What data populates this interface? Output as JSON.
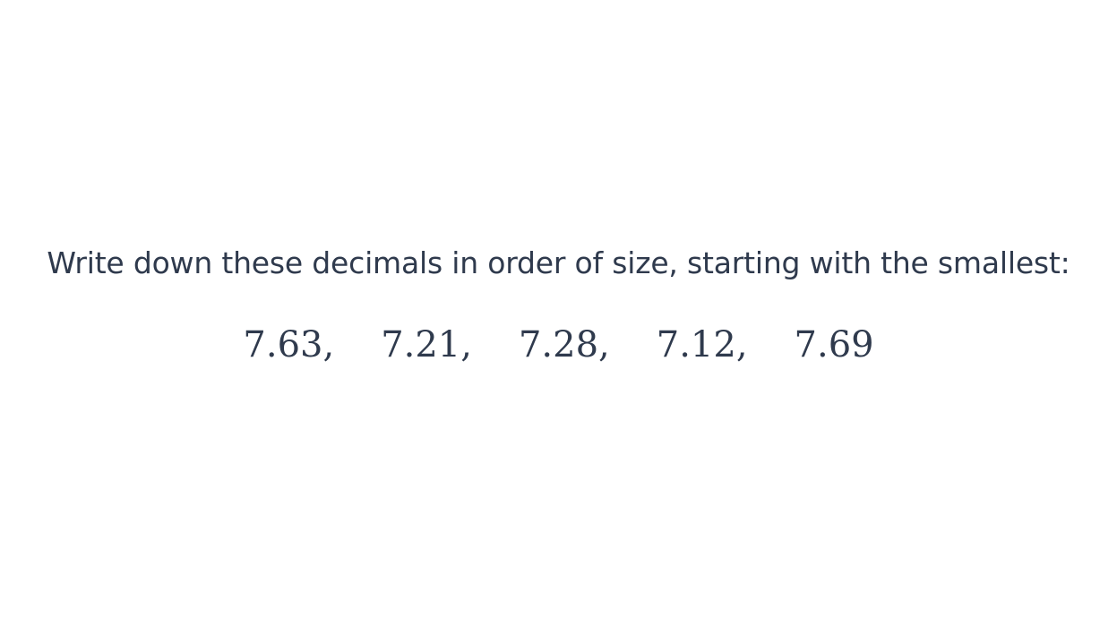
{
  "question": {
    "prompt": "Write down these decimals in order of size, starting with the smallest:",
    "numbers": [
      "7.63,",
      "7.21,",
      "7.28,",
      "7.12,",
      "7.69"
    ]
  }
}
